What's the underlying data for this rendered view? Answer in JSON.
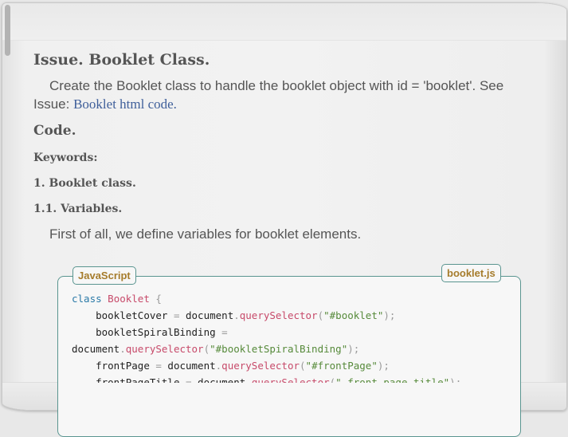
{
  "issue_title": "Issue. Booklet Class.",
  "description_prefix": "Create the Booklet class to handle the booklet object with id = 'booklet'. See Issue: ",
  "description_link": "Booklet html code.",
  "code_heading": "Code.",
  "keywords_heading": "Keywords:",
  "section_1": "1. Booklet class.",
  "section_1_1": "1.1. Variables.",
  "variables_text": "First of all, we define variables for booklet elements.",
  "code_language": "JavaScript",
  "code_filename": "booklet.js",
  "code_lines": [
    {
      "kw": "class",
      "cls": "Booklet",
      "rest": " {"
    },
    {
      "var": "bookletCover",
      "sel": "\"#booklet\""
    },
    {
      "var": "bookletSpiralBinding",
      "sel": "\"#bookletSpiralBinding\"",
      "wrap": true
    },
    {
      "var": "frontPage",
      "sel": "\"#frontPage\""
    },
    {
      "var": "frontPageTitle",
      "sel": "\".front-page-title\""
    }
  ]
}
